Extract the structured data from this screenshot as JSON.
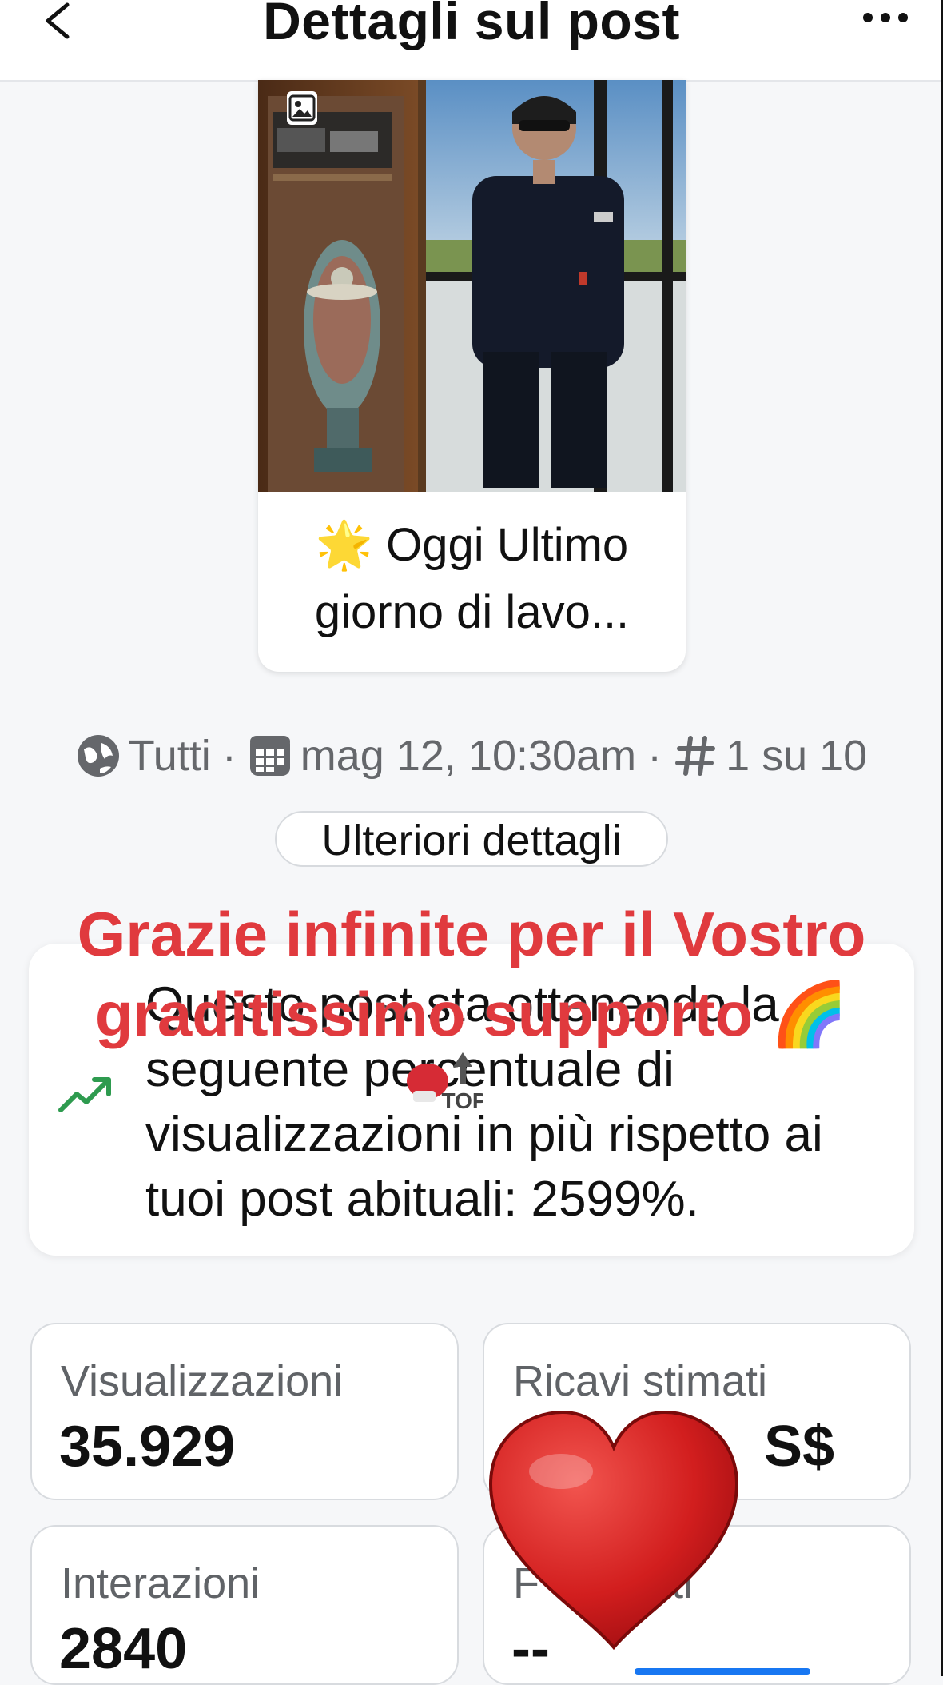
{
  "header": {
    "title": "Dettagli sul post",
    "back_icon": "chevron-left-icon",
    "more_icon": "more-horizontal-icon"
  },
  "post": {
    "image_icon": "image-icon",
    "caption_line1": "🌟 Oggi Ultimo",
    "caption_line2": "giorno di lavo..."
  },
  "meta": {
    "audience_icon": "globe-icon",
    "audience": "Tutti",
    "separator": "·",
    "date_icon": "calendar-icon",
    "date": "mag 12, 10:30am",
    "rank_icon": "hashtag-icon",
    "rank": "1 su 10"
  },
  "details_button": "Ulteriori dettagli",
  "insight": {
    "icon": "trending-up-icon",
    "text": "Questo post sta ottenendo la seguente percentuale di visualizzazioni in più rispetto ai tuoi post abituali: 2599%."
  },
  "overlay": {
    "line1": "Grazie infinite per il Vostro",
    "line2": "graditissimo supporto 🌈",
    "sticker_text": "TOP",
    "sticker_icons": [
      "boxing-glove-icon",
      "arrow-up-icon"
    ],
    "color": "#e03a3e"
  },
  "stats": [
    {
      "label": "Visualizzazioni",
      "value": "35.929"
    },
    {
      "label": "Ricavi stimati",
      "value": "S$"
    },
    {
      "label": "Interazioni",
      "value": "2840"
    },
    {
      "label": "F      netti",
      "value": "--"
    }
  ],
  "heart_sticker": "heart-icon",
  "colors": {
    "accent_blue": "#1877f2",
    "trend_green": "#2e9b4f",
    "text_secondary": "#65676b"
  }
}
